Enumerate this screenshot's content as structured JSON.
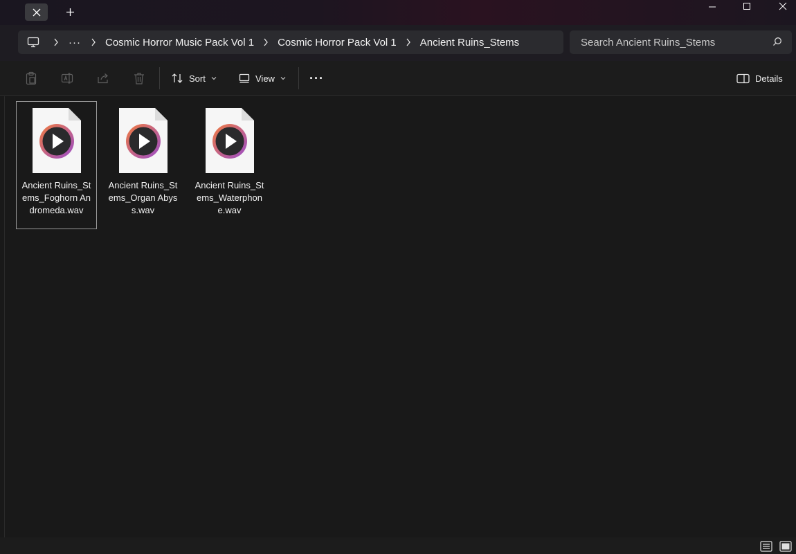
{
  "titlebar": {
    "tab_close_icon": "close-icon",
    "new_tab_icon": "plus-icon",
    "window_controls": [
      "minimize-icon",
      "maximize-icon",
      "close-icon"
    ]
  },
  "address": {
    "overflow_label": "···",
    "crumbs": [
      "Cosmic Horror Music Pack Vol 1",
      "Cosmic Horror Pack Vol 1",
      "Ancient Ruins_Stems"
    ]
  },
  "search": {
    "placeholder": "Search Ancient Ruins_Stems"
  },
  "toolbar": {
    "sort_label": "Sort",
    "view_label": "View",
    "more_label": "···",
    "details_label": "Details"
  },
  "files": [
    {
      "name": "Ancient Ruins_Stems_Foghorn Andromeda.wav",
      "selected": true
    },
    {
      "name": "Ancient Ruins_Stems_Organ Abyss.wav",
      "selected": false
    },
    {
      "name": "Ancient Ruins_Stems_Waterphone.wav",
      "selected": false
    }
  ],
  "colors": {
    "background": "#191919",
    "toolbar": "#1c1c1c",
    "address_bg": "#2b2b2f",
    "media_ring_start": "#f07b3f",
    "media_ring_end": "#9b4dca"
  }
}
